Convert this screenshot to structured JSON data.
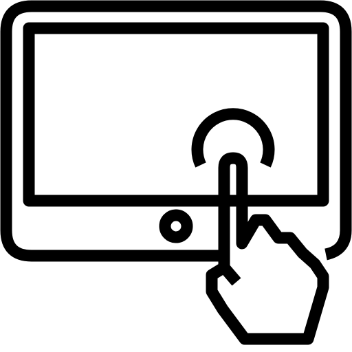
{
  "icon": {
    "name": "tablet-touch-icon",
    "stroke_color": "#000000",
    "background_color": "#ffffff",
    "parts": [
      "tablet-body",
      "tablet-screen",
      "home-button",
      "touch-ripple",
      "pointing-hand"
    ]
  }
}
